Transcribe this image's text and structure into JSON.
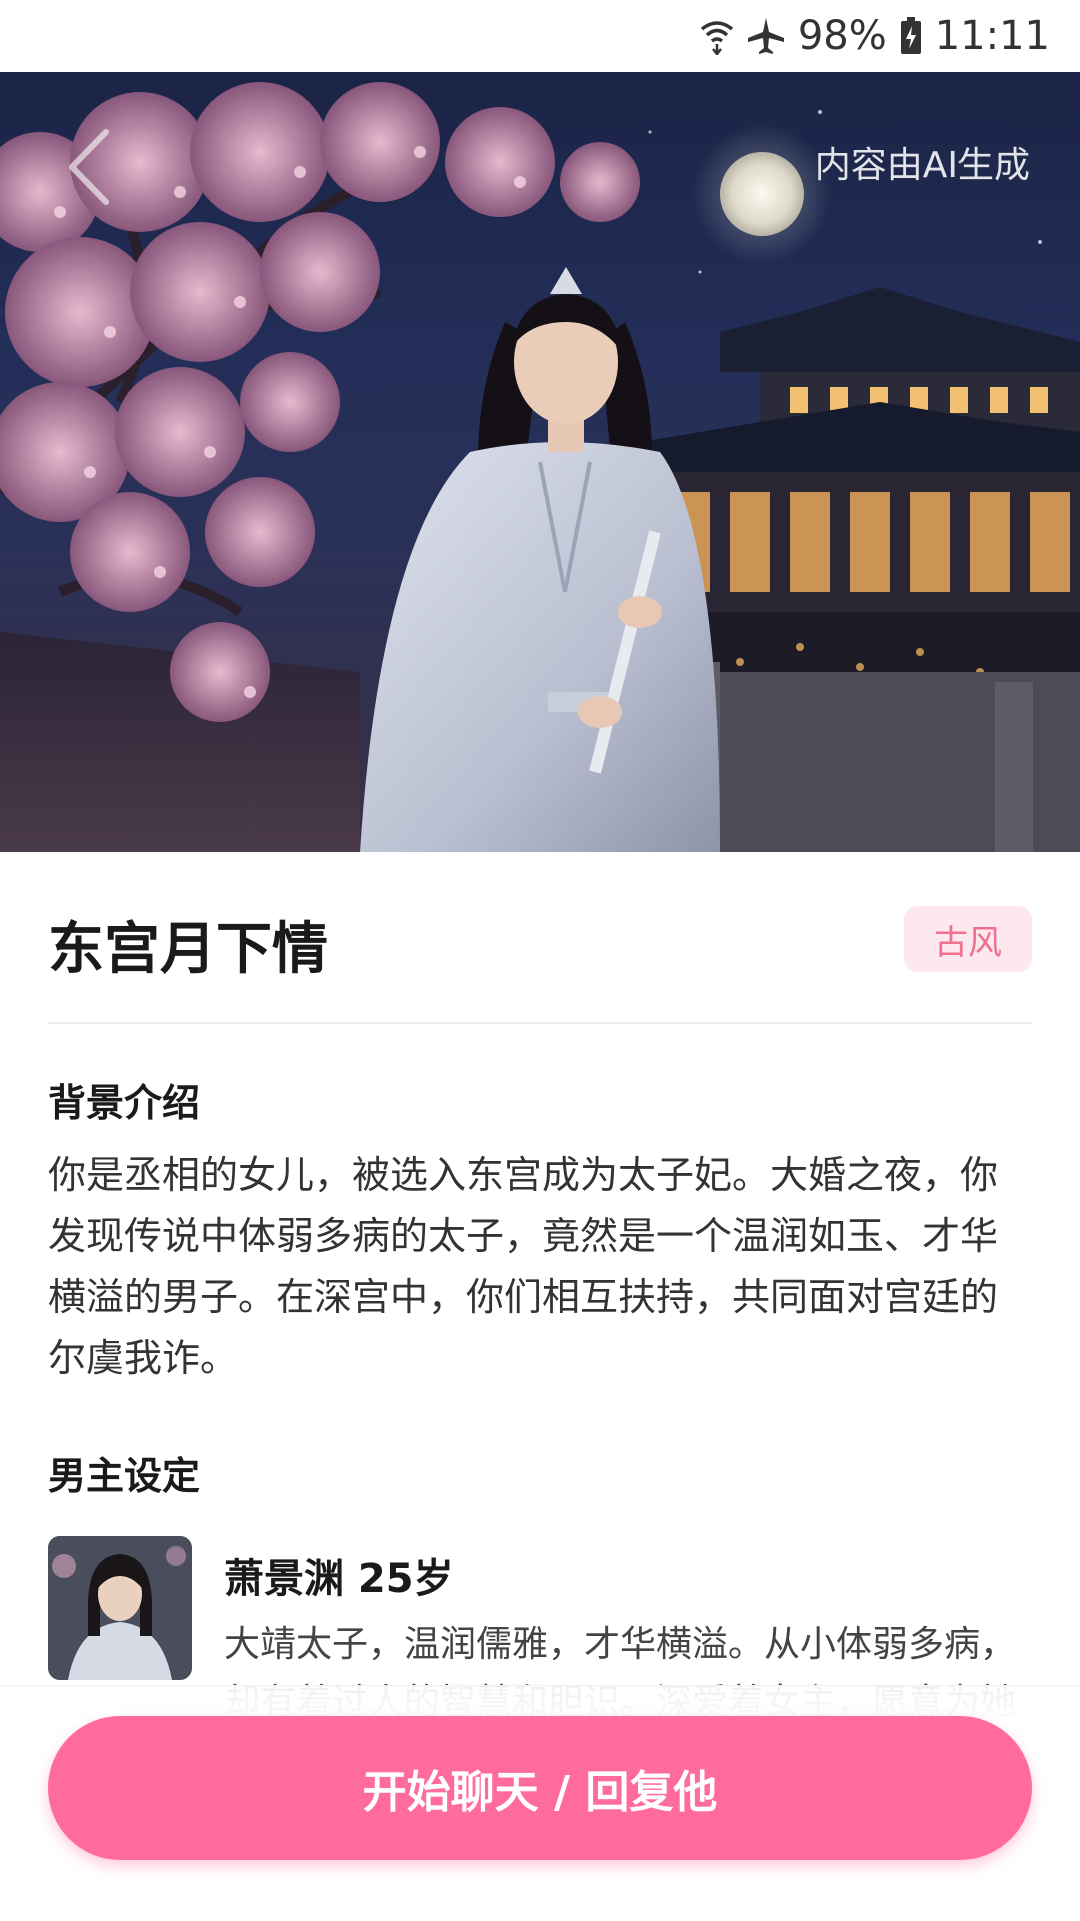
{
  "status_bar": {
    "battery": "98%",
    "time": "11:11",
    "icons": [
      "wifi-icon",
      "airplane-icon",
      "battery-charging-icon"
    ]
  },
  "header": {
    "ai_label": "内容由AI生成",
    "back_icon": "back-chevron-icon"
  },
  "story": {
    "title": "东宫月下情",
    "tag": "古风",
    "background_heading": "背景介绍",
    "background_text": "你是丞相的女儿，被选入东宫成为太子妃。大婚之夜，你发现传说中体弱多病的太子，竟然是一个温润如玉、才华横溢的男子。在深宫中，你们相互扶持，共同面对宫廷的尔虞我诈。",
    "character_heading": "男主设定",
    "character": {
      "name_age": "萧景渊  25岁",
      "description": "大靖太子，温润儒雅，才华横溢。从小体弱多病，却有着过人的智慧和胆识。深爱着女主，愿意为她"
    }
  },
  "actions": {
    "start_button": "开始聊天 / 回复他"
  },
  "colors": {
    "accent": "#ff6b9a",
    "tag_bg": "#fde8ef",
    "tag_text": "#f0708f"
  }
}
